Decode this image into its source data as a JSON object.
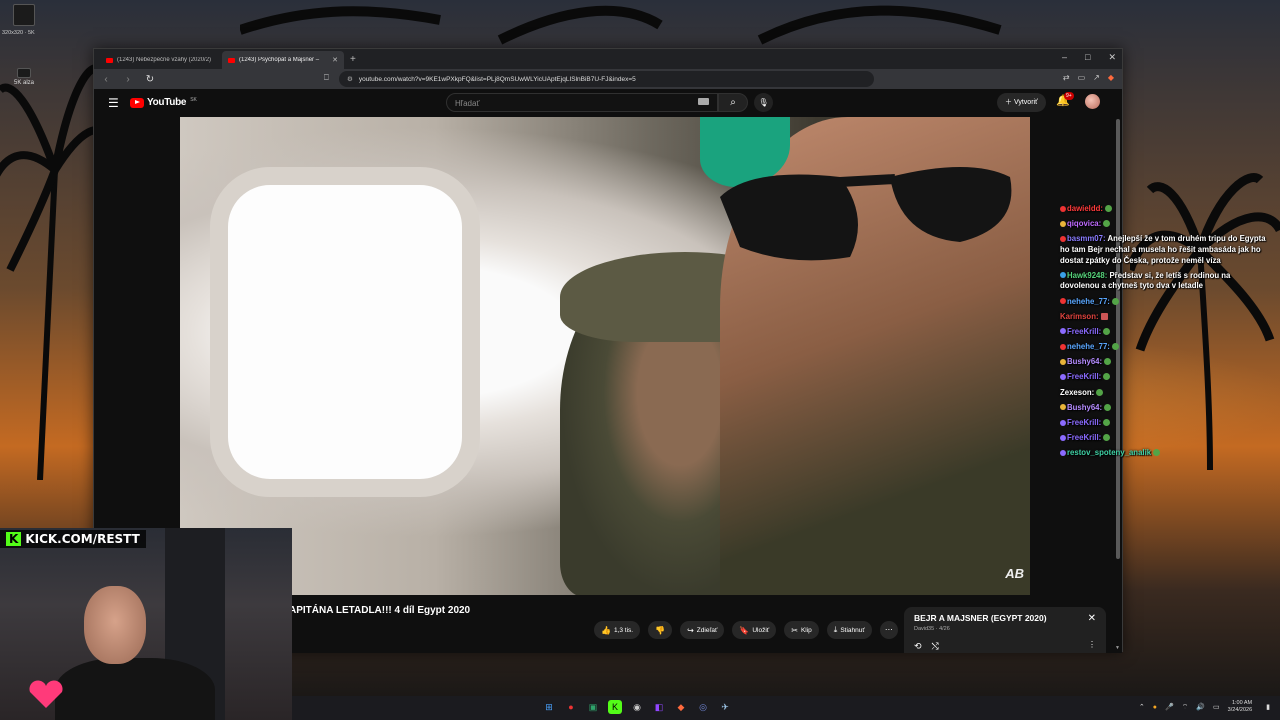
{
  "desktop": {
    "resolution_label": "320x320 · 5K",
    "icon2_label": "5K alza"
  },
  "browser": {
    "tabs": [
      {
        "title": "(1243) Nebezpečné vzahy (2020/2)",
        "active": false
      },
      {
        "title": "(1243) Psychopat a Majsner –",
        "active": true
      }
    ],
    "url": "youtube.com/watch?v=9KE1wPXkpFQ&list=PLj8QmSUwWLYicUAptEjqLISlnBiB7U-FJ&index=5",
    "window_controls": [
      "–",
      "□",
      "✕"
    ]
  },
  "youtube": {
    "logo_text": "YouTube",
    "region": "SK",
    "search_placeholder": "Hľadať",
    "create_label": "Vytvoriť",
    "notif_count": "9+",
    "video_title": "APITÁNA LETADLA!!! 4 díl Egypt 2020",
    "watermark": "AB",
    "actions": {
      "like_count": "1,3 tis.",
      "share": "Zdieľať",
      "save": "Uložiť",
      "clip": "Klip",
      "download": "Stiahnuť"
    },
    "playlist": {
      "title": "BEJR A MAJSNER (EGYPT 2020)",
      "subtitle": "David35 · 4/26"
    }
  },
  "chat": [
    {
      "user": "dawieldd:",
      "color": "#ff3b3b",
      "text": ""
    },
    {
      "user": "qiqovica:",
      "color": "#c06bff",
      "text": ""
    },
    {
      "user": "basmm07:",
      "color": "#8a7cff",
      "text": "Anejlepší že v tom druhém tripu do Egypta ho tam Bejr nechal a musela ho řešit ambasáda jak ho dostat zpátky do Česka, protože neměl víza"
    },
    {
      "user": "Hawk9248:",
      "color": "#56d27a",
      "text": "Představ si, že letíš s rodinou na dovolenou a chytneš tyto dva v letadle"
    },
    {
      "user": "nehehe_77:",
      "color": "#5aa7ff",
      "text": ""
    },
    {
      "user": "Karimson:",
      "color": "#e0443f",
      "text": ""
    },
    {
      "user": "FreeKrill:",
      "color": "#8b6bff",
      "text": ""
    },
    {
      "user": "nehehe_77:",
      "color": "#5aa7ff",
      "text": ""
    },
    {
      "user": "Bushy64:",
      "color": "#b58cff",
      "text": ""
    },
    {
      "user": "FreeKrill:",
      "color": "#8b6bff",
      "text": ""
    },
    {
      "user": "Zexeson:",
      "color": "#ffffff",
      "text": ""
    },
    {
      "user": "Bushy64:",
      "color": "#b58cff",
      "text": ""
    },
    {
      "user": "FreeKrill:",
      "color": "#8b6bff",
      "text": ""
    },
    {
      "user": "FreeKrill:",
      "color": "#8b6bff",
      "text": ""
    },
    {
      "user": "restov_spoteny_analik",
      "color": "#3fd1a5",
      "text": ""
    }
  ],
  "stream": {
    "kick_label": "KICK.COM/RESTT",
    "kick_logo": "K"
  },
  "taskbar": {
    "time": "1:00 AM",
    "date": "3/24/2026"
  },
  "colors": {
    "youtube_red": "#ff0000",
    "kick_green": "#53fc18"
  }
}
